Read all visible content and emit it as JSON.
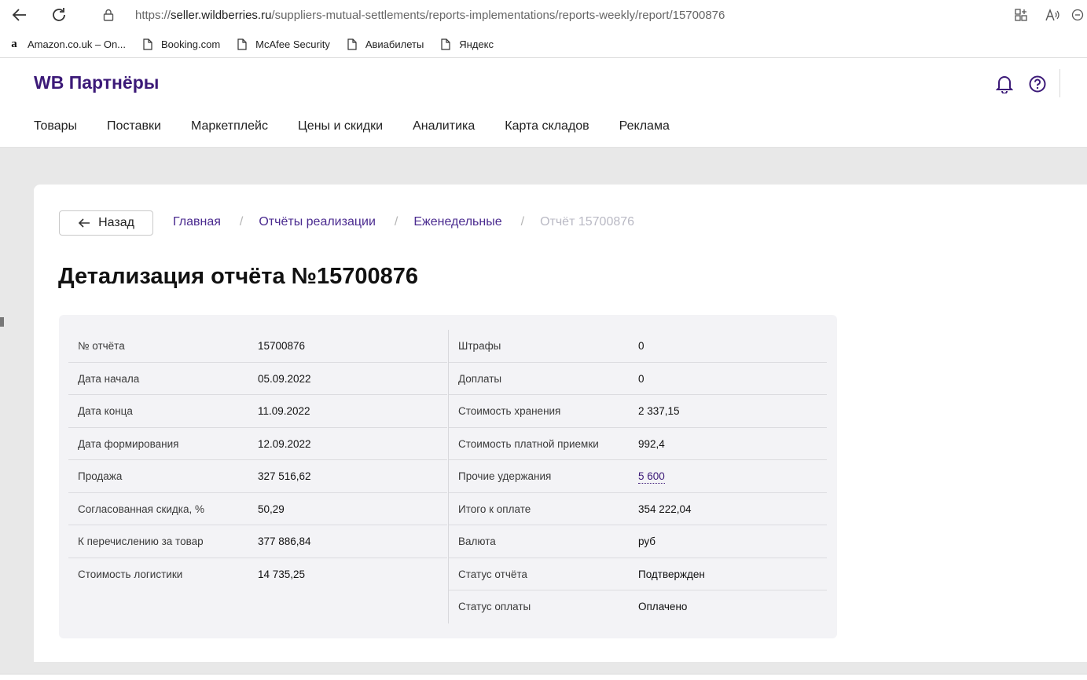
{
  "browser": {
    "url_prefix": "https://",
    "url_domain": "seller.wildberries.ru",
    "url_path": "/suppliers-mutual-settlements/reports-implementations/reports-weekly/report/15700876",
    "bookmarks": [
      {
        "label": "Amazon.co.uk – On..."
      },
      {
        "label": "Booking.com"
      },
      {
        "label": "McAfee Security"
      },
      {
        "label": "Авиабилеты"
      },
      {
        "label": "Яндекс"
      }
    ]
  },
  "header": {
    "logo": "WB Партнёры",
    "menu": [
      "Товары",
      "Поставки",
      "Маркетплейс",
      "Цены и скидки",
      "Аналитика",
      "Карта складов",
      "Реклама"
    ]
  },
  "back_label": "Назад",
  "breadcrumbs": {
    "home": "Главная",
    "reports": "Отчёты реализации",
    "weekly": "Еженедельные",
    "current": "Отчёт 15700876",
    "sep": "/"
  },
  "title": "Детализация отчёта №15700876",
  "details": {
    "left": [
      {
        "label": "№ отчёта",
        "value": "15700876"
      },
      {
        "label": "Дата начала",
        "value": "05.09.2022"
      },
      {
        "label": "Дата конца",
        "value": "11.09.2022"
      },
      {
        "label": "Дата формирования",
        "value": "12.09.2022"
      },
      {
        "label": "Продажа",
        "value": "327 516,62"
      },
      {
        "label": "Согласованная скидка, %",
        "value": "50,29"
      },
      {
        "label": "К перечислению за товар",
        "value": "377 886,84"
      },
      {
        "label": "Стоимость логистики",
        "value": "14 735,25"
      }
    ],
    "right": [
      {
        "label": "Штрафы",
        "value": "0"
      },
      {
        "label": "Доплаты",
        "value": "0"
      },
      {
        "label": "Стоимость хранения",
        "value": "2 337,15"
      },
      {
        "label": "Стоимость платной приемки",
        "value": "992,4"
      },
      {
        "label": "Прочие удержания",
        "value": "5 600"
      },
      {
        "label": "Итого к оплате",
        "value": "354 222,04"
      },
      {
        "label": "Валюта",
        "value": "руб"
      },
      {
        "label": "Статус отчёта",
        "value": "Подтвержден"
      },
      {
        "label": "Статус оплаты",
        "value": "Оплачено"
      }
    ]
  },
  "colors": {
    "brand": "#3c1a78",
    "link": "#4a2a8f",
    "panel": "#f3f3f6",
    "canvas": "#e8e8e8"
  }
}
